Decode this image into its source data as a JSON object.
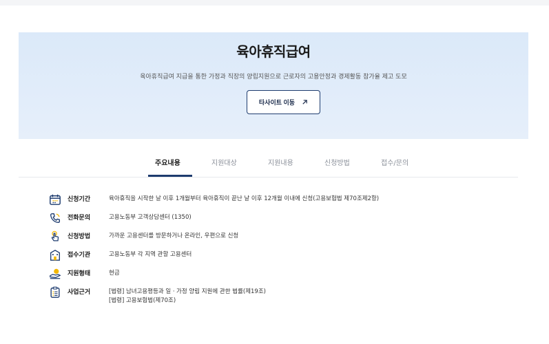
{
  "hero": {
    "title": "육아휴직급여",
    "description": "육아휴직급여 지급을 통한 가정과 직장의 양립지원으로 근로자의 고용안정과 경제활동 참가율 제고 도모",
    "button_label": "타사이트 이동",
    "button_icon": "arrow-up-right-icon"
  },
  "tabs": [
    {
      "label": "주요내용",
      "active": true
    },
    {
      "label": "지원대상",
      "active": false
    },
    {
      "label": "지원내용",
      "active": false
    },
    {
      "label": "신청방법",
      "active": false
    },
    {
      "label": "접수/문의",
      "active": false
    }
  ],
  "info": [
    {
      "icon": "calendar-icon",
      "label": "신청기간",
      "values": [
        "육아휴직을 시작한 날 이후 1개월부터 육아휴직이 끝난 날 이후 12개월 이내에 신청(고용보험법 제70조제2항)"
      ]
    },
    {
      "icon": "phone-icon",
      "label": "전화문의",
      "values": [
        "고용노동부 고객상담센터 (1350)"
      ]
    },
    {
      "icon": "hand-pointer-icon",
      "label": "신청방법",
      "values": [
        "가까운 고용센터를 방문하거나 온라인, 우편으로 신청"
      ]
    },
    {
      "icon": "building-icon",
      "label": "접수기관",
      "values": [
        "고용노동부 각 지역 관할 고용센터"
      ]
    },
    {
      "icon": "hand-coin-icon",
      "label": "지원형태",
      "values": [
        "현금"
      ]
    },
    {
      "icon": "clipboard-icon",
      "label": "사업근거",
      "values": [
        "[법령] 남녀고용평등과 일ㆍ가정 양립 지원에 관한 법률(제19조)",
        "[법령] 고용보험법(제70조)"
      ]
    }
  ],
  "colors": {
    "accent": "#1d3b6e",
    "icon_primary": "#1d3b6e",
    "icon_highlight": "#f2b705",
    "hero_bg": "#dde9f8"
  }
}
